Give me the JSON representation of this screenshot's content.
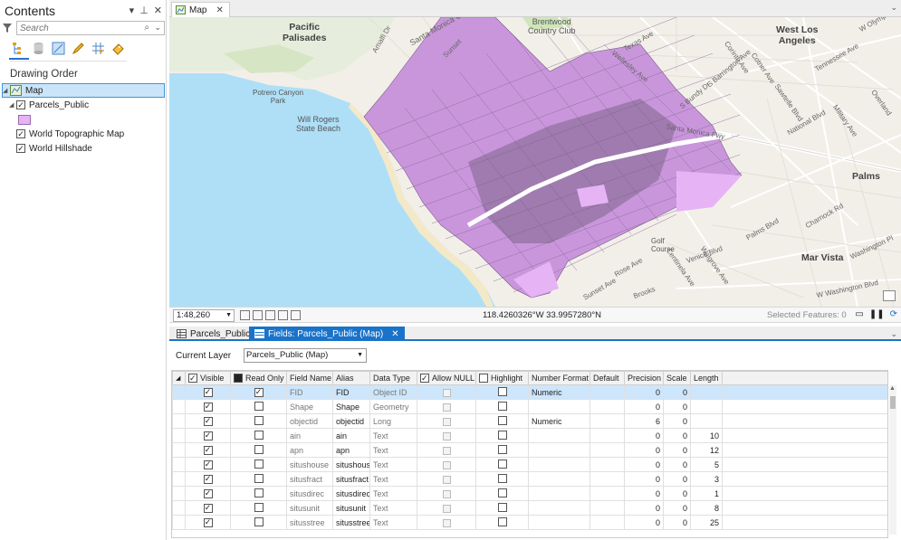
{
  "contents": {
    "title": "Contents",
    "search_placeholder": "Search",
    "drawing_order_label": "Drawing Order",
    "layers": [
      {
        "label": "Map"
      },
      {
        "label": "Parcels_Public"
      },
      {
        "label": "World Topographic Map"
      },
      {
        "label": "World Hillshade"
      }
    ]
  },
  "map_view": {
    "tab_label": "Map",
    "scale": "1:48,260",
    "coordinates": "118.4260326°W 33.9957280°N",
    "selected_features": "Selected Features: 0",
    "labels": {
      "pacific_palisades": "Pacific\nPalisades",
      "brentwood": "Brentwood\nCountry Club",
      "west_la": "West Los\nAngeles",
      "palms": "Palms",
      "mar_vista": "Mar Vista",
      "will_rogers": "Will Rogers\nState Beach",
      "potrero": "Potrero Canyon\nPark",
      "golf": "Golf\nCourse",
      "santa_monica_fwy": "Santa Monica Fwy",
      "santa_monica_c": "Santa Monica C",
      "national_blvd": "National Blvd",
      "barrington": "S Barrington Ave",
      "bundy": "S Bundy Dr",
      "wellesley": "Wellesley Ave",
      "texas": "Texas Ave",
      "sawtelle": "Sawtelle Blvd",
      "military": "Military Ave",
      "palms_blvd": "Palms Blvd",
      "charnock": "Charnock Rd",
      "washington": "W Washington Blvd",
      "venice": "Venice Blvd",
      "rose": "Rose Ave",
      "sunset": "Sunset Ave",
      "walgrove": "Walgrove Ave",
      "centinela": "Centinela Ave",
      "olympic": "W Olympic",
      "tennessee": "Tennessee Ave",
      "cotner": "Cotner Ave",
      "corinth": "Corinth Ave",
      "washington_pl": "Washington Pl",
      "overland": "Overland",
      "amalfi": "Amalfi Dr",
      "sunset_bl": "Sunset",
      "brooks": "Brooks"
    }
  },
  "fields_view": {
    "tabs": [
      {
        "label": "Parcels_Public"
      },
      {
        "label": "Fields: Parcels_Public (Map)"
      }
    ],
    "current_layer_label": "Current Layer",
    "current_layer_value": "Parcels_Public (Map)",
    "columns": [
      "Visible",
      "Read Only",
      "Field Name",
      "Alias",
      "Data Type",
      "Allow NULL",
      "Highlight",
      "Number Format",
      "Default",
      "Precision",
      "Scale",
      "Length"
    ],
    "rows": [
      {
        "visible": true,
        "read_only": true,
        "field": "FID",
        "alias": "FID",
        "type": "Object ID",
        "number_format": "Numeric",
        "precision": "0",
        "scale": "0",
        "length": ""
      },
      {
        "visible": true,
        "read_only": false,
        "field": "Shape",
        "alias": "Shape",
        "type": "Geometry",
        "number_format": "",
        "precision": "0",
        "scale": "0",
        "length": ""
      },
      {
        "visible": true,
        "read_only": false,
        "field": "objectid",
        "alias": "objectid",
        "type": "Long",
        "number_format": "Numeric",
        "precision": "6",
        "scale": "0",
        "length": ""
      },
      {
        "visible": true,
        "read_only": false,
        "field": "ain",
        "alias": "ain",
        "type": "Text",
        "number_format": "",
        "precision": "0",
        "scale": "0",
        "length": "10"
      },
      {
        "visible": true,
        "read_only": false,
        "field": "apn",
        "alias": "apn",
        "type": "Text",
        "number_format": "",
        "precision": "0",
        "scale": "0",
        "length": "12"
      },
      {
        "visible": true,
        "read_only": false,
        "field": "situshouse",
        "alias": "situshouse",
        "type": "Text",
        "number_format": "",
        "precision": "0",
        "scale": "0",
        "length": "5"
      },
      {
        "visible": true,
        "read_only": false,
        "field": "situsfract",
        "alias": "situsfract",
        "type": "Text",
        "number_format": "",
        "precision": "0",
        "scale": "0",
        "length": "3"
      },
      {
        "visible": true,
        "read_only": false,
        "field": "situsdirec",
        "alias": "situsdirec",
        "type": "Text",
        "number_format": "",
        "precision": "0",
        "scale": "0",
        "length": "1"
      },
      {
        "visible": true,
        "read_only": false,
        "field": "situsunit",
        "alias": "situsunit",
        "type": "Text",
        "number_format": "",
        "precision": "0",
        "scale": "0",
        "length": "8"
      },
      {
        "visible": true,
        "read_only": false,
        "field": "situsstree",
        "alias": "situsstree",
        "type": "Text",
        "number_format": "",
        "precision": "0",
        "scale": "0",
        "length": "25"
      }
    ]
  },
  "colors": {
    "accent": "#1a73c9",
    "parcel_fill": "#e6b3f5",
    "water": "#aedff7",
    "land": "#f2efe9",
    "selection": "#cde6fb"
  }
}
